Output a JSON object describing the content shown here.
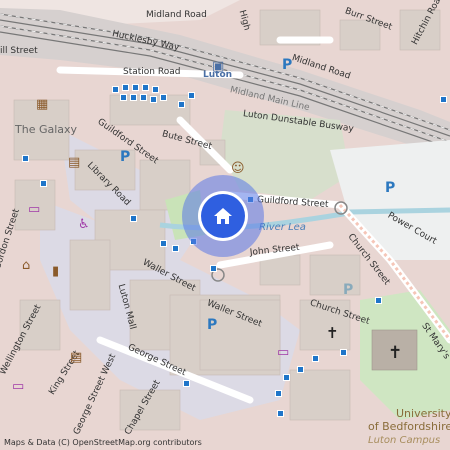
{
  "map": {
    "attribution": "Maps & Data (C) OpenStreetMap.org contributors",
    "colors": {
      "background": "#f2efe9",
      "built": "#e6d0cc",
      "buildings": "#d9d0c9",
      "pedestrian": "#dddde8",
      "railway": "#c7c0c0",
      "green": "#cde6c0",
      "water": "#aad3df",
      "marker": "#2f5fe0",
      "parking": "#2c78bf"
    },
    "streets": {
      "midland_road_top": "Midland Road",
      "midland_road_right": "Midland Road",
      "hucklesby_way": "Hucklesby Way",
      "burr_street": "Burr Street",
      "hitchin_road": "Hitchin Road",
      "high": "High",
      "hill_street": "ill Street",
      "station_road": "Station Road",
      "midland_main_line": "Midland Main Line",
      "luton_dunstable_busway": "Luton Dunstable Busway",
      "bute_street": "Bute Street",
      "guildford_street_upper": "Guildford Street",
      "guildford_street_lower": "Guildford Street",
      "library_road": "Library Road",
      "power_court": "Power Court",
      "church_street_right": "Church Street",
      "church_street_lower": "Church Street",
      "john_street": "John Street",
      "waller_street_upper": "Waller Street",
      "waller_street_lower": "Waller Street",
      "luton_mall": "Luton Mall",
      "gordon_street": "Gordon Street",
      "wellington_street": "Wellington Street",
      "king_street": "King Street",
      "george_street": "George Street",
      "george_street_west": "George Street West",
      "chapel_street": "Chapel Street",
      "st_marys": "St Mary's"
    },
    "places": {
      "luton": "Luton",
      "the_galaxy": "The Galaxy",
      "river_lea": "River Lea",
      "university_line1": "University",
      "university_line2": "of Bedfordshire",
      "luton_campus": "Luton Campus"
    },
    "parking_label": "P"
  }
}
